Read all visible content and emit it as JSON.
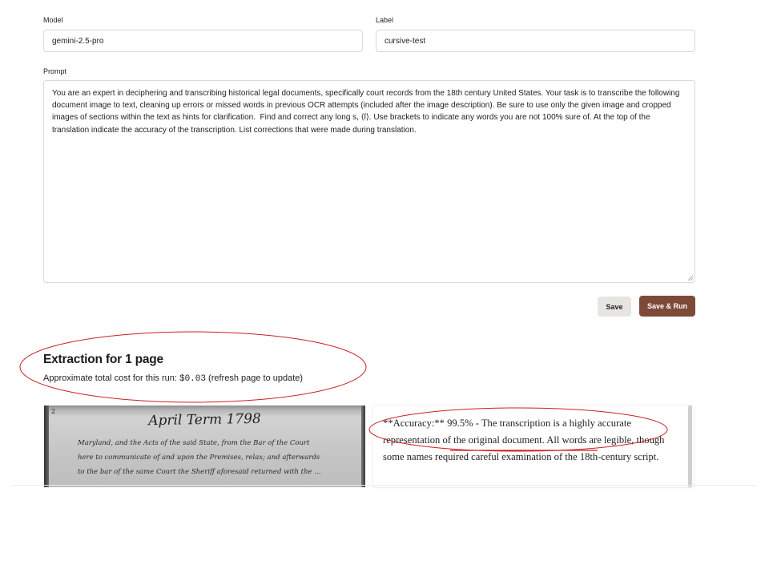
{
  "form": {
    "model_label": "Model",
    "model_value": "gemini-2.5-pro",
    "label_label": "Label",
    "label_value": "cursive-test",
    "prompt_label": "Prompt",
    "prompt_value": "You are an expert in deciphering and transcribing historical legal documents, specifically court records from the 18th century United States. Your task is to transcribe the following document image to text, cleaning up errors or missed words in previous OCR attempts (included after the image description). Be sure to use only the given image and cropped images of sections within the text as hints for clarification.  Find and correct any long s, ⟨ſ⟩. Use brackets to indicate any words you are not 100% sure of. At the top of the translation indicate the accuracy of the transcription. List corrections that were made during translation."
  },
  "actions": {
    "save_label": "Save",
    "save_run_label": "Save & Run"
  },
  "extraction": {
    "title": "Extraction for 1 page",
    "cost_prefix": "Approximate total cost for this run: ",
    "cost_value": "$0.03",
    "cost_suffix": " (refresh page to update)"
  },
  "document_image": {
    "page_number": "2",
    "heading": "April Term 1798",
    "lines": [
      "Maryland, and the Acts of the said State, from the Bar of the Court",
      "here to communicate of and upon the Premises, relax; and afterwards",
      "to the bar of the same Court the Sheriff aforesaid returned with the ..."
    ]
  },
  "transcription": {
    "text": "**Accuracy:** 99.5% - The transcription is a highly accurate representation of the original document. All words are legible, though some names required careful examination of the 18th-century script."
  },
  "annotation_color": "#cc1f1f",
  "colors": {
    "primary_button": "#7e4a38",
    "secondary_button": "#e6e5e1"
  }
}
